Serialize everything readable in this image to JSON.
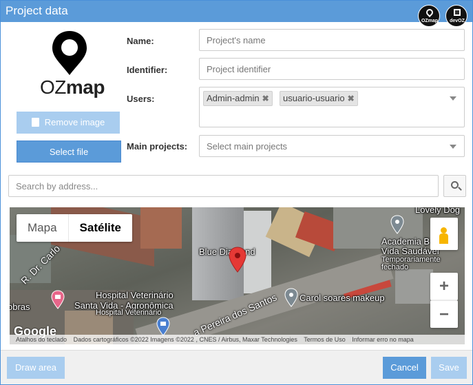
{
  "dialog": {
    "title": "Project data",
    "badges": [
      "OZmap",
      "devOZ"
    ]
  },
  "logo": {
    "text_plain": "OZ",
    "text_bold": "map"
  },
  "image_buttons": {
    "remove_label": "Remove image",
    "select_label": "Select file"
  },
  "form": {
    "name": {
      "label": "Name:",
      "placeholder": "Project's name"
    },
    "identifier": {
      "label": "Identifier:",
      "placeholder": "Project identifier"
    },
    "users": {
      "label": "Users:",
      "tags": [
        "Admin-admin",
        "usuario-usuario"
      ]
    },
    "main_projects": {
      "label": "Main projects:",
      "placeholder": "Select main projects"
    }
  },
  "address_search": {
    "placeholder": "Search by address..."
  },
  "map": {
    "type_options": [
      "Mapa",
      "Satélite"
    ],
    "selected_type": "Satélite",
    "labels": {
      "blue_diamond": "Blue Diamond",
      "lovely_dog": "Lovely Dog",
      "academia_1": "Academia B",
      "academia_2": "Vida Saudável",
      "academia_3": "Temporariamente",
      "academia_4": "fechado",
      "carol": "Carol soares makeup",
      "hospital_1": "Hospital Veterinário",
      "hospital_2": "Santa Vida - Agronômica",
      "hospital_3": "Hospital Veterinário",
      "obras": "obras",
      "street_1": "R. Dr. Carlo",
      "street_2": "a Pereira dos Santos"
    },
    "zoom_in": "+",
    "zoom_out": "−",
    "google": "Google",
    "attribution": [
      "Atalhos do teclado",
      "Dados cartográficos ©2022 Imagens ©2022 , CNES / Airbus, Maxar Technologies",
      "Termos de Uso",
      "Informar erro no mapa"
    ]
  },
  "footer": {
    "draw_label": "Draw area",
    "cancel_label": "Cancel",
    "save_label": "Save"
  },
  "colors": {
    "primary": "#5b9bd9",
    "primary_disabled": "#a9cdef",
    "pin_red": "#e53935"
  }
}
